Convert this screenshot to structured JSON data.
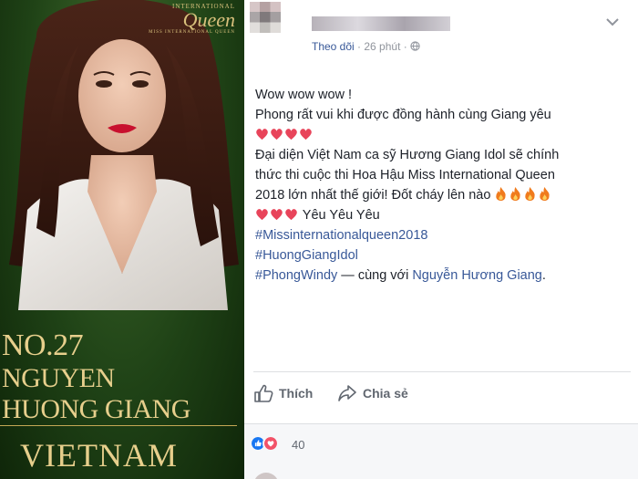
{
  "card": {
    "logo_top": "INTERNATIONAL",
    "logo_main": "Queen",
    "logo_sub": "MISS INTERNATIONAL QUEEN",
    "number": "NO.27",
    "name_line1": "NGUYEN",
    "name_line2": "HUONG GIANG",
    "country": "VIETNAM"
  },
  "post": {
    "follow_label": "Theo dõi",
    "separator": " · ",
    "time": "26 phút",
    "lines": {
      "l1": "Wow wow wow !",
      "l2": "Phong rất vui khi được đồng hành cùng Giang yêu",
      "l4": "Đại diện Việt Nam ca sỹ Hương Giang Idol sẽ chính",
      "l5": "thức thi cuộc thi Hoa Hậu Miss International Queen",
      "l6": "2018 lớn nhất thế giới! Đốt cháy lên nào",
      "l7": "Yêu Yêu Yêu",
      "hashtag1": "#Missinternationalqueen2018",
      "hashtag2": "#HuongGiangIdol",
      "hashtag3": "#PhongWindy",
      "tag_prefix": " — cùng với ",
      "tagged_name": "Nguyễn Hương Giang",
      "tag_suffix": "."
    }
  },
  "actions": {
    "like_label": "Thích",
    "share_label": "Chia sẻ"
  },
  "reactions": {
    "count": "40"
  },
  "icons": {
    "heart": "heart-emoji",
    "fire": "fire-emoji",
    "globe": "globe-icon",
    "like": "thumbs-up-icon",
    "share": "share-arrow-icon",
    "chevron": "chevron-down-icon"
  },
  "colors": {
    "link": "#385898",
    "text": "#1d2129",
    "meta": "#90949c",
    "card_gold": "#e7cf8c",
    "card_green": "#1f4216",
    "heart": "#e8445a",
    "like_blue": "#1877f2",
    "love_red": "#f25268"
  }
}
